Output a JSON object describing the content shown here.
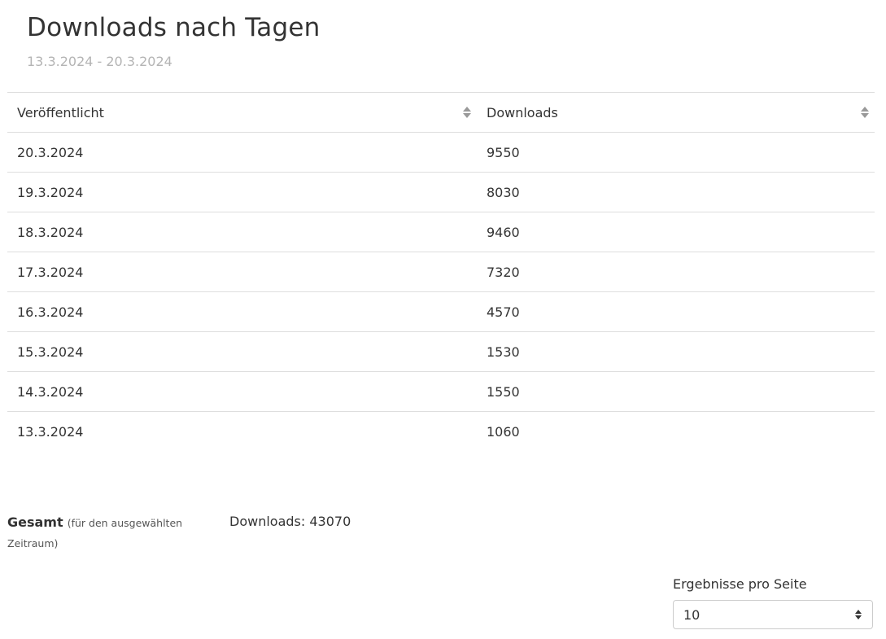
{
  "header": {
    "title": "Downloads nach Tagen",
    "date_range": "13.3.2024 - 20.3.2024"
  },
  "table": {
    "columns": [
      {
        "label": "Veröffentlicht",
        "sort_icon": "sort-icon"
      },
      {
        "label": "Downloads",
        "sort_icon": "sort-icon"
      }
    ],
    "rows": [
      {
        "date": "20.3.2024",
        "downloads": "9550"
      },
      {
        "date": "19.3.2024",
        "downloads": "8030"
      },
      {
        "date": "18.3.2024",
        "downloads": "9460"
      },
      {
        "date": "17.3.2024",
        "downloads": "7320"
      },
      {
        "date": "16.3.2024",
        "downloads": "4570"
      },
      {
        "date": "15.3.2024",
        "downloads": "1530"
      },
      {
        "date": "14.3.2024",
        "downloads": "1550"
      },
      {
        "date": "13.3.2024",
        "downloads": "1060"
      }
    ]
  },
  "summary": {
    "label": "Gesamt",
    "note": "(für den ausgewählten Zeitraum)",
    "value_text": "Downloads: 43070"
  },
  "pagination": {
    "per_page_label": "Ergebnisse pro Seite",
    "per_page_value": "10",
    "icon": "select-arrows-icon"
  },
  "colors": {
    "text": "#333333",
    "muted": "#b4b4b4",
    "border": "#dedede",
    "sort_icon": "#999999"
  }
}
